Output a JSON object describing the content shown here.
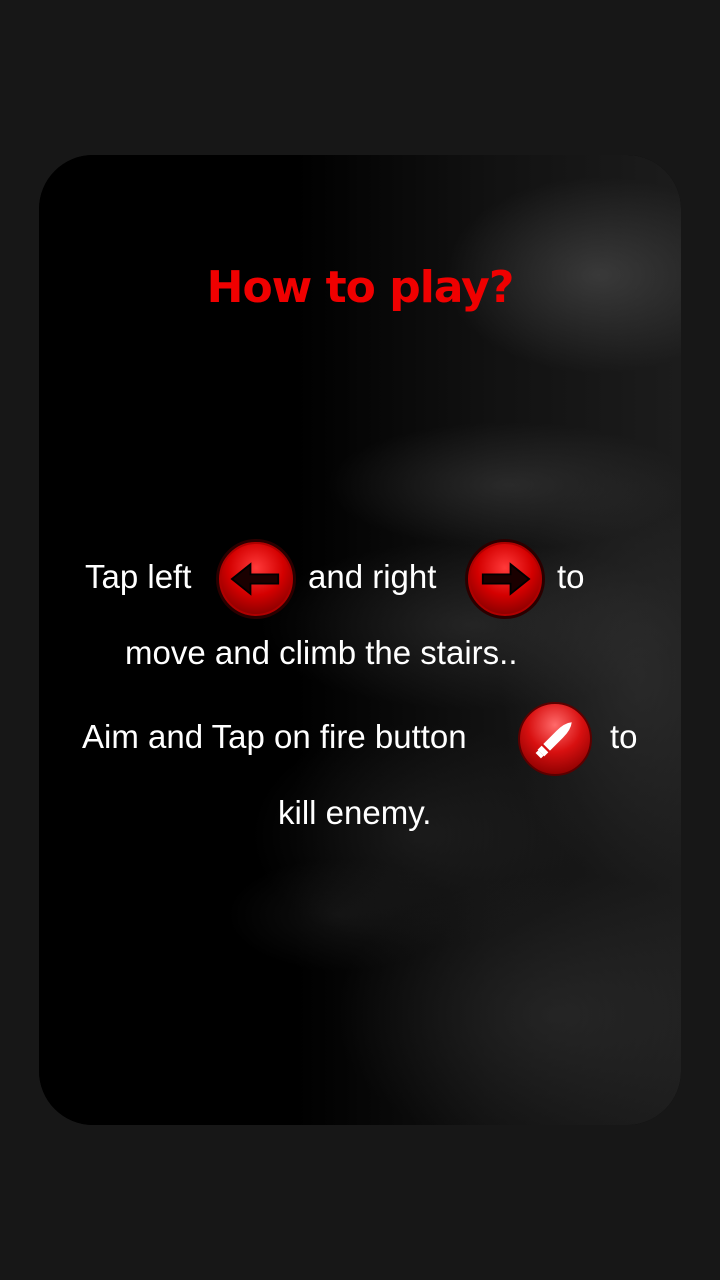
{
  "title": "How to play?",
  "instructions": {
    "line1_a": "Tap left",
    "line1_b": "and right",
    "line1_c": "to",
    "line2": "move and climb the  stairs..",
    "line3_a": "Aim and Tap on fire button",
    "line3_b": "to",
    "line4": "kill enemy."
  },
  "buttons": {
    "left_icon": "left-arrow-icon",
    "right_icon": "right-arrow-icon",
    "fire_icon": "bullet-icon"
  },
  "colors": {
    "title": "#f00000",
    "text": "#ffffff",
    "button": "#d40000",
    "background": "#171717"
  }
}
